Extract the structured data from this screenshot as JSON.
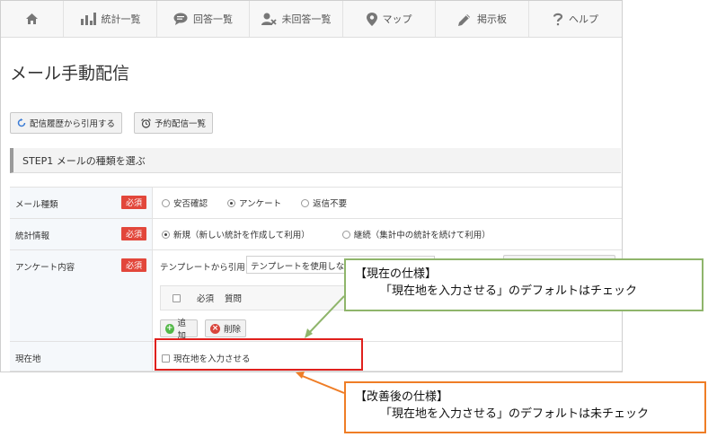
{
  "nav": {
    "items": [
      {
        "id": "home",
        "label": "",
        "icon": "home-icon"
      },
      {
        "id": "stats",
        "label": "統計一覧",
        "icon": "bar-chart-icon"
      },
      {
        "id": "answers",
        "label": "回答一覧",
        "icon": "chat-bubble-icon"
      },
      {
        "id": "unanswered",
        "label": "未回答一覧",
        "icon": "user-x-icon"
      },
      {
        "id": "map",
        "label": "マップ",
        "icon": "map-pin-icon"
      },
      {
        "id": "board",
        "label": "掲示板",
        "icon": "pencil-icon"
      },
      {
        "id": "help",
        "label": "ヘルプ",
        "icon": "question-icon"
      }
    ]
  },
  "page": {
    "title": "メール手動配信"
  },
  "toolbar": {
    "history_label": "配信履歴から引用する",
    "scheduled_label": "予約配信一覧"
  },
  "step1": {
    "title": "STEP1 メールの種類を選ぶ"
  },
  "form": {
    "required_badge": "必須",
    "mail_type": {
      "label": "メール種類",
      "options": [
        "安否確認",
        "アンケート",
        "返信不要"
      ],
      "selected": "アンケート"
    },
    "stats": {
      "label": "統計情報",
      "options": [
        "新規（新しい統計を作成して利用）",
        "継続（集計中の統計を続けて利用）"
      ],
      "selected": "新規（新しい統計を作成して利用）"
    },
    "survey": {
      "label": "アンケート内容",
      "template_label": "テンプレートから引用：",
      "template_value": "テンプレートを使用しない",
      "col_required": "必須",
      "col_question": "質問",
      "add_label": "追加",
      "delete_label": "削除"
    },
    "location": {
      "label": "現在地",
      "checkbox_label": "現在地を入力させる",
      "checked": false
    }
  },
  "annotations": {
    "current": {
      "title": "【現在の仕様】",
      "body": "「現在地を入力させる」のデフォルトはチェック"
    },
    "improved": {
      "title": "【改善後の仕様】",
      "body": "「現在地を入力させる」のデフォルトは未チェック"
    },
    "colors": {
      "current": "#8fb56b",
      "improved": "#ef7d26",
      "highlight": "#e0201d",
      "required": "#e2473b"
    }
  }
}
